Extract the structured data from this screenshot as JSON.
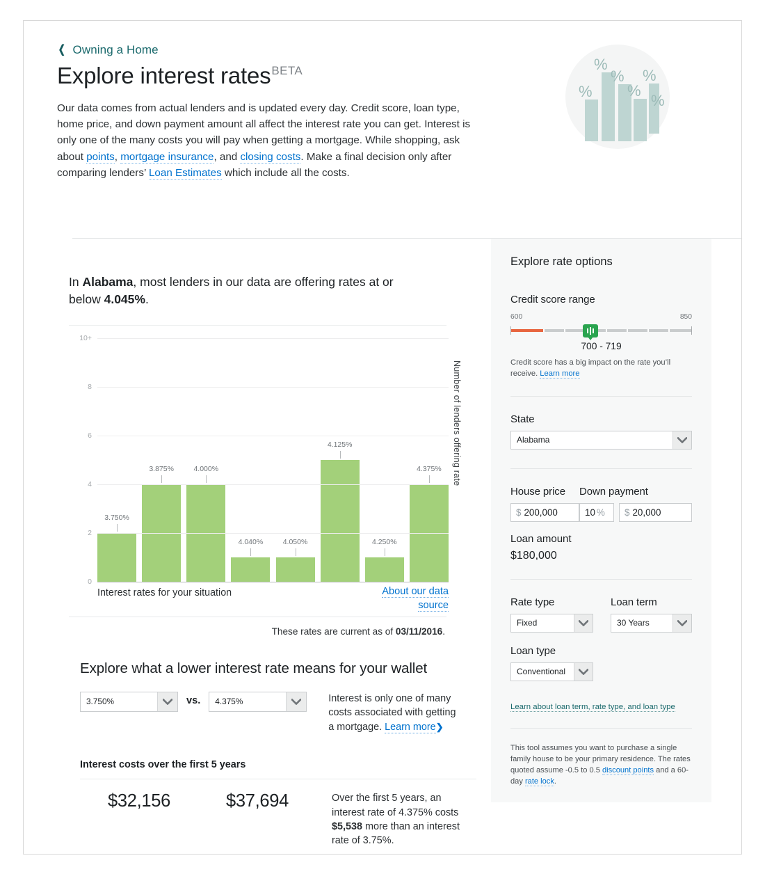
{
  "header": {
    "breadcrumb": "Owning a Home",
    "title": "Explore interest rates",
    "beta": "BETA",
    "intro_1": "Our data comes from actual lenders and is updated every day. Credit score, loan type, home price, and down payment amount all affect the interest rate you can get. Interest is only one of the many costs you will pay when getting a mortgage. While shopping, ask about ",
    "link_points": "points",
    "intro_2": ", ",
    "link_mi": "mortgage insurance",
    "intro_3": ", and ",
    "link_closing": "closing costs",
    "intro_4": ". Make a final decision only after comparing lenders’ ",
    "link_le": "Loan Estimates",
    "intro_5": " which include all the costs."
  },
  "chart_data": {
    "type": "bar",
    "title": "",
    "lede_pre": "In ",
    "lede_state": "Alabama",
    "lede_mid": ", most lenders in our data are offering rates at or below ",
    "lede_rate": "4.045%",
    "lede_end": ".",
    "categories": [
      "3.750%",
      "3.875%",
      "4.000%",
      "4.040%",
      "4.050%",
      "4.125%",
      "4.250%",
      "4.375%"
    ],
    "values": [
      2,
      4,
      4,
      1,
      1,
      5,
      1,
      4
    ],
    "xlabel": "Interest rates for your situation",
    "ylabel": "Number of lenders offering rate",
    "yticks": [
      "0",
      "2",
      "4",
      "6",
      "8",
      "10+"
    ],
    "ytick_values": [
      0,
      2,
      4,
      6,
      8,
      10
    ],
    "ylim": [
      0,
      10
    ],
    "grid": true,
    "legend": "none",
    "bar_color": "#a3d07a",
    "source_link": "About our data source",
    "as_of_prefix": "These rates are current as of ",
    "as_of_date": "03/11/2016",
    "as_of_suffix": "."
  },
  "wallet": {
    "heading": "Explore what a lower interest rate means for your wallet",
    "rate_a": "3.750%",
    "vs": "vs.",
    "rate_b": "4.375%",
    "note_1": "Interest is only one of many costs associated with getting a mortgage. ",
    "note_link": "Learn more",
    "note_chev": "❯",
    "costs_heading": "Interest costs over the first 5 years",
    "cost_a": "$32,156",
    "cost_b": "$37,694",
    "cost_note_1": "Over the first 5 years, an interest rate of 4.375% costs ",
    "cost_note_bold": "$5,538",
    "cost_note_2": " more than an interest rate of 3.75%."
  },
  "options": {
    "panel_title": "Explore rate options",
    "credit_label": "Credit score range",
    "credit_min": "600",
    "credit_max": "850",
    "credit_value": "700 - 719",
    "credit_note_1": "Credit score has a big impact on the rate you’ll receive. ",
    "credit_note_link": "Learn more",
    "state_label": "State",
    "state_value": "Alabama",
    "house_price_label": "House price",
    "house_price_symbol": "$",
    "house_price_value": "200,000",
    "down_payment_label": "Down payment",
    "down_payment_pct": "10",
    "down_payment_pct_symbol": "%",
    "down_payment_symbol": "$",
    "down_payment_value": "20,000",
    "loan_amount_label": "Loan amount",
    "loan_amount_value": "$180,000",
    "rate_type_label": "Rate type",
    "rate_type_value": "Fixed",
    "loan_term_label": "Loan term",
    "loan_term_value": "30 Years",
    "loan_type_label": "Loan type",
    "loan_type_value": "Conventional",
    "learn_link": "Learn about loan term, rate type, and loan type",
    "disclaimer_1": "This tool assumes you want to purchase a single family house to be your primary residence. The rates quoted assume -0.5 to 0.5 ",
    "disclaimer_link_1": "discount points",
    "disclaimer_2": " and a 60-day ",
    "disclaimer_link_2": "rate lock",
    "disclaimer_3": "."
  },
  "colors": {
    "accent_teal": "#1b6a6d",
    "link_blue": "#0072ce",
    "bar_green": "#a3d07a",
    "handle_green": "#2aa44f",
    "slider_red": "#e8653f"
  }
}
